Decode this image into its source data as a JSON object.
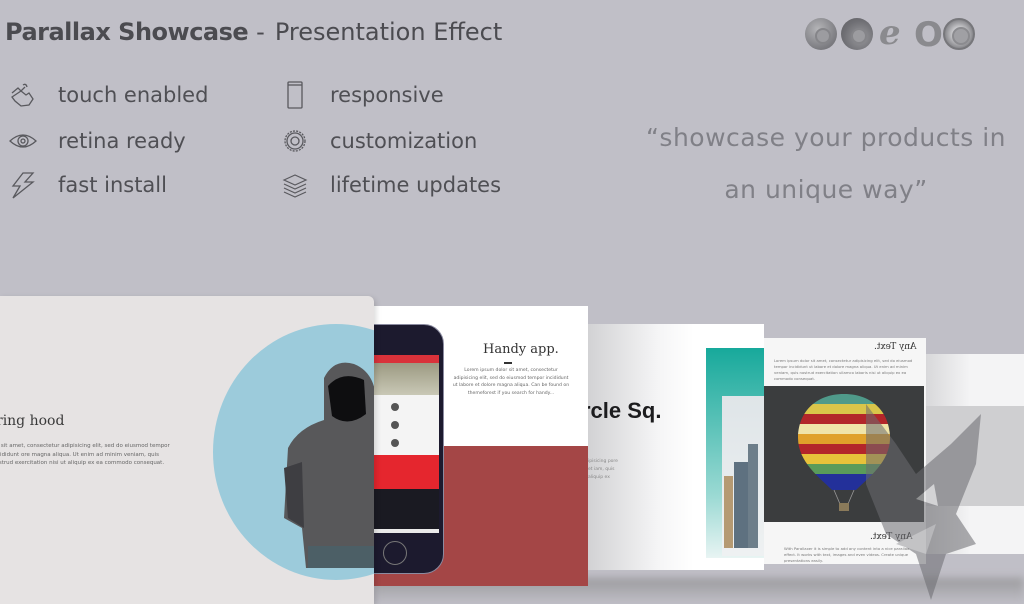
{
  "header": {
    "title_bold": "Parallax Showcase",
    "separator": "-",
    "title_light": "Presentation Effect"
  },
  "browsers": [
    {
      "name": "chrome-icon"
    },
    {
      "name": "firefox-icon"
    },
    {
      "name": "internet-explorer-icon",
      "glyph": "e"
    },
    {
      "name": "opera-icon",
      "glyph": "O"
    },
    {
      "name": "safari-icon"
    }
  ],
  "features": [
    {
      "icon": "touch-hand-icon",
      "label": "touch enabled"
    },
    {
      "icon": "eye-icon",
      "label": "retina ready"
    },
    {
      "icon": "lightning-icon",
      "label": "fast install"
    },
    {
      "icon": "mobile-device-icon",
      "label": "responsive"
    },
    {
      "icon": "gear-icon",
      "label": "customization"
    },
    {
      "icon": "layers-icon",
      "label": "lifetime updates"
    }
  ],
  "quote": {
    "line1": "“showcase your products in",
    "line2": "an unique way”"
  },
  "slides": {
    "hood": {
      "title": "ring hood",
      "body": "lor sit amet, consectetur adipisicing elit, sed do eiusmod tempor incididunt ore magna aliqua. Ut enim ad minim veniam, quis nostrud exercitation nisi ut aliquip ex ea commodo consequat."
    },
    "app": {
      "title": "Handy app.",
      "body": "Lorem ipsum dolor sit amet, consectetur adipisicing elit, sed do eiusmod tempor incididunt ut labore et dolore magna aliqua. Can be found on themeforest if you search for handy..."
    },
    "circle": {
      "title": "rcle Sq.",
      "body": "ipisicing pore et iam, quis aliquip ex"
    },
    "balloon": {
      "title": "Any Text.",
      "body": "Lorem ipsum dolor sit amet, consectetur adipisicing elit, sed do eiusmod tempor incididunt ut labore et dolore magna aliqua. Ut enim ad minim veniam, quis nostrud exercitation ullamco laboris nisi ut aliquip ex ea commodo consequat.",
      "title2": "Any Text.",
      "body2": "With Parallaxer it is simple to add any content into a nice parallax effect. It works with text, images and even videos. Create unique presentations easily."
    }
  },
  "colors": {
    "background": "#c0bfc7",
    "hood_circle": "#9ccbdb",
    "app_red": "#a44646",
    "teal": "#17a99b",
    "balloon_dark": "#3b3d3e"
  }
}
